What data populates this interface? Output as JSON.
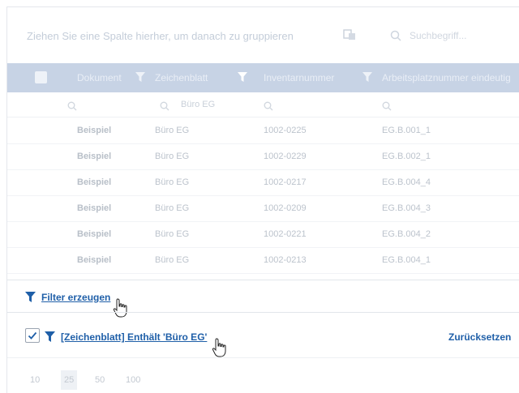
{
  "grouping": {
    "hint": "Ziehen Sie eine Spalte hierher, um danach zu gruppieren",
    "search_placeholder": "Suchbegriff..."
  },
  "table": {
    "columns": [
      "Dokument",
      "Zeichenblatt",
      "Inventarnummer",
      "Arbeitsplatznummer eindeutig"
    ],
    "filter_value": "Büro EG",
    "rows": [
      [
        "Beispiel",
        "Büro EG",
        "1002-0225",
        "EG.B.001_1"
      ],
      [
        "Beispiel",
        "Büro EG",
        "1002-0229",
        "EG.B.002_1"
      ],
      [
        "Beispiel",
        "Büro EG",
        "1002-0217",
        "EG.B.004_4"
      ],
      [
        "Beispiel",
        "Büro EG",
        "1002-0209",
        "EG.B.004_3"
      ],
      [
        "Beispiel",
        "Büro EG",
        "1002-0221",
        "EG.B.004_2"
      ],
      [
        "Beispiel",
        "Büro EG",
        "1002-0213",
        "EG.B.004_1"
      ]
    ]
  },
  "filter_panel": {
    "create_label": "Filter erzeugen",
    "active_filter_label": "[Zeichenblatt] Enthält 'Büro EG'",
    "reset_label": "Zurücksetzen"
  },
  "pager": {
    "sizes": [
      "10",
      "25",
      "50",
      "100"
    ],
    "selected": "25"
  },
  "colors": {
    "header_bg": "#c7d3e5",
    "link": "#1f5fa8",
    "funnel": "#1f5fa8"
  }
}
